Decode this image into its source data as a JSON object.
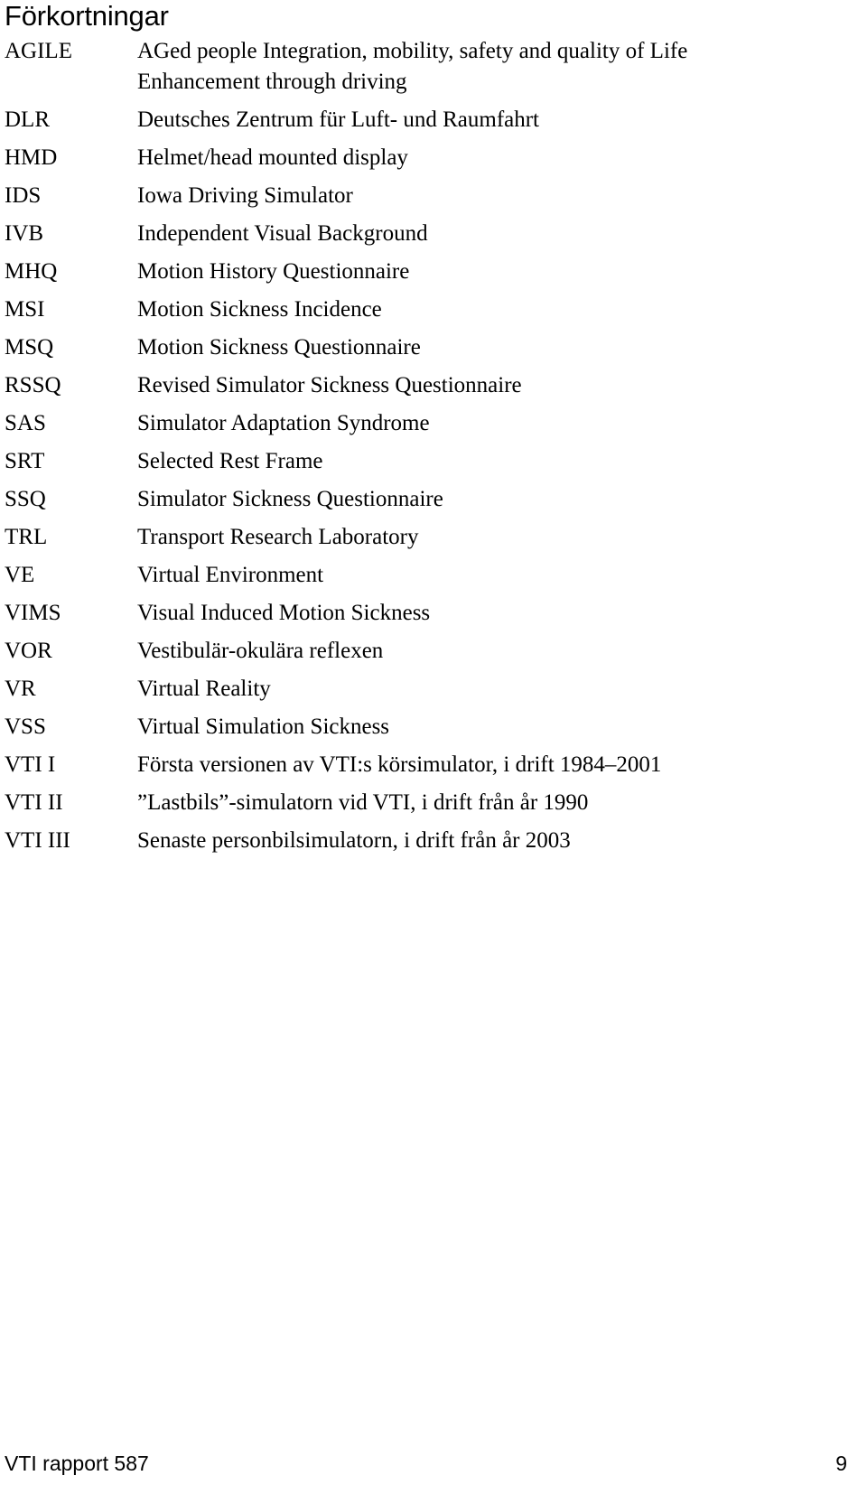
{
  "document": {
    "title": "Förkortningar"
  },
  "abbreviations": [
    {
      "term": "AGILE",
      "definition_lines": [
        "AGed people Integration, mobility, safety and quality of Life",
        "Enhancement through driving"
      ]
    },
    {
      "term": "DLR",
      "definition_lines": [
        "Deutsches Zentrum für Luft- und Raumfahrt"
      ]
    },
    {
      "term": "HMD",
      "definition_lines": [
        "Helmet/head mounted display"
      ]
    },
    {
      "term": "IDS",
      "definition_lines": [
        "Iowa Driving Simulator"
      ]
    },
    {
      "term": "IVB",
      "definition_lines": [
        "Independent Visual Background"
      ]
    },
    {
      "term": "MHQ",
      "definition_lines": [
        "Motion History Questionnaire"
      ]
    },
    {
      "term": "MSI",
      "definition_lines": [
        "Motion Sickness Incidence"
      ]
    },
    {
      "term": "MSQ",
      "definition_lines": [
        "Motion Sickness Questionnaire"
      ]
    },
    {
      "term": "RSSQ",
      "definition_lines": [
        "Revised Simulator Sickness Questionnaire"
      ]
    },
    {
      "term": "SAS",
      "definition_lines": [
        "Simulator Adaptation Syndrome"
      ]
    },
    {
      "term": "SRT",
      "definition_lines": [
        "Selected Rest Frame"
      ]
    },
    {
      "term": "SSQ",
      "definition_lines": [
        "Simulator Sickness Questionnaire"
      ]
    },
    {
      "term": "TRL",
      "definition_lines": [
        "Transport Research Laboratory"
      ]
    },
    {
      "term": "VE",
      "definition_lines": [
        "Virtual Environment"
      ]
    },
    {
      "term": "VIMS",
      "definition_lines": [
        "Visual Induced Motion Sickness"
      ]
    },
    {
      "term": "VOR",
      "definition_lines": [
        "Vestibulär-okulära reflexen"
      ]
    },
    {
      "term": "VR",
      "definition_lines": [
        "Virtual Reality"
      ]
    },
    {
      "term": "VSS",
      "definition_lines": [
        "Virtual Simulation Sickness"
      ]
    },
    {
      "term": "VTI I",
      "definition_lines": [
        "Första versionen av VTI:s körsimulator, i drift 1984–2001"
      ]
    },
    {
      "term": "VTI II",
      "definition_lines": [
        "”Lastbils”-simulatorn vid VTI, i drift från år 1990"
      ]
    },
    {
      "term": "VTI III",
      "definition_lines": [
        "Senaste personbilsimulatorn, i drift från år 2003"
      ]
    }
  ],
  "footer": {
    "report": "VTI rapport 587",
    "page_number": "9"
  }
}
